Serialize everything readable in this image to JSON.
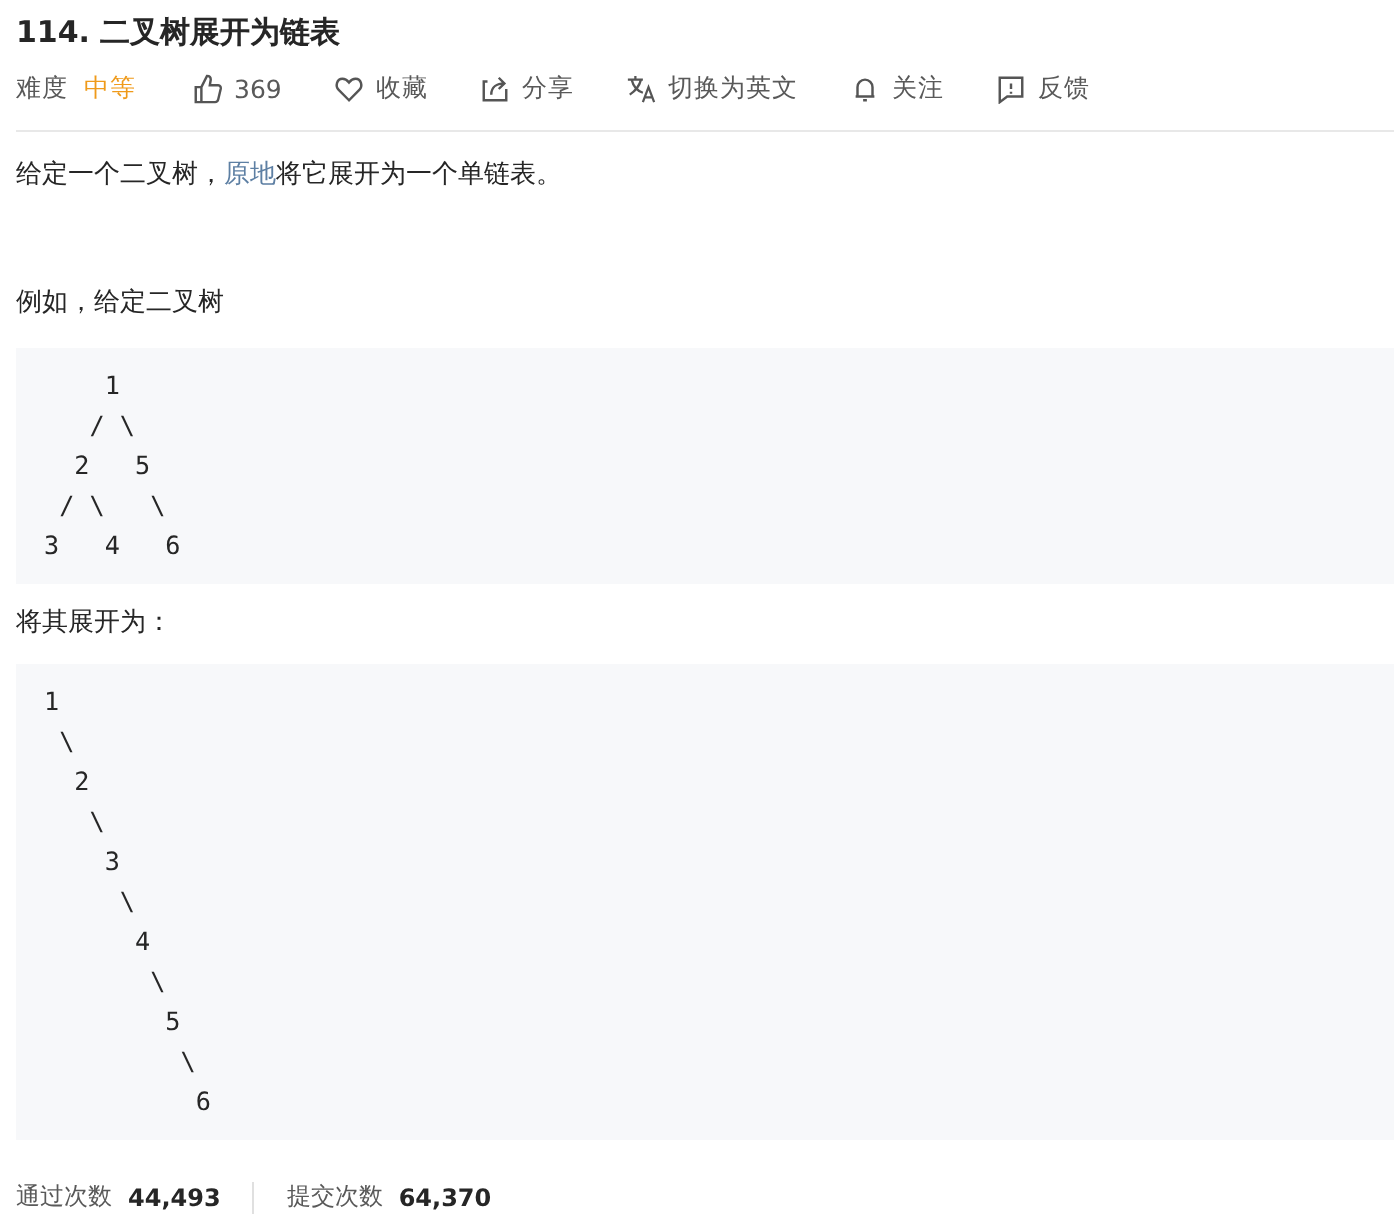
{
  "title": "114. 二叉树展开为链表",
  "meta": {
    "difficulty_label": "难度",
    "difficulty": "中等",
    "actions": [
      {
        "kind": "like",
        "label": "369"
      },
      {
        "kind": "favorite",
        "label": "收藏"
      },
      {
        "kind": "share",
        "label": "分享"
      },
      {
        "kind": "translate",
        "label": "切换为英文"
      },
      {
        "kind": "follow",
        "label": "关注"
      },
      {
        "kind": "feedback",
        "label": "反馈"
      }
    ]
  },
  "description": [
    {
      "kind": "text",
      "parts": [
        {
          "text": "给定一个二叉树，",
          "link": false
        },
        {
          "text": "原地",
          "link": true
        },
        {
          "text": "将它展开为一个单链表。",
          "link": false
        }
      ]
    },
    {
      "kind": "text",
      "parts": [
        {
          "text": "例如，给定二叉树",
          "link": false
        }
      ]
    },
    {
      "kind": "code",
      "text": "    1\n   / \\\n  2   5\n / \\   \\\n3   4   6"
    },
    {
      "kind": "text",
      "parts": [
        {
          "text": "将其展开为：",
          "link": false
        }
      ]
    },
    {
      "kind": "code",
      "text": "1\n \\\n  2\n   \\\n    3\n     \\\n      4\n       \\\n        5\n         \\\n          6"
    }
  ],
  "stats": [
    {
      "label": "通过次数",
      "value": "44,493"
    },
    {
      "label": "提交次数",
      "value": "64,370"
    }
  ]
}
